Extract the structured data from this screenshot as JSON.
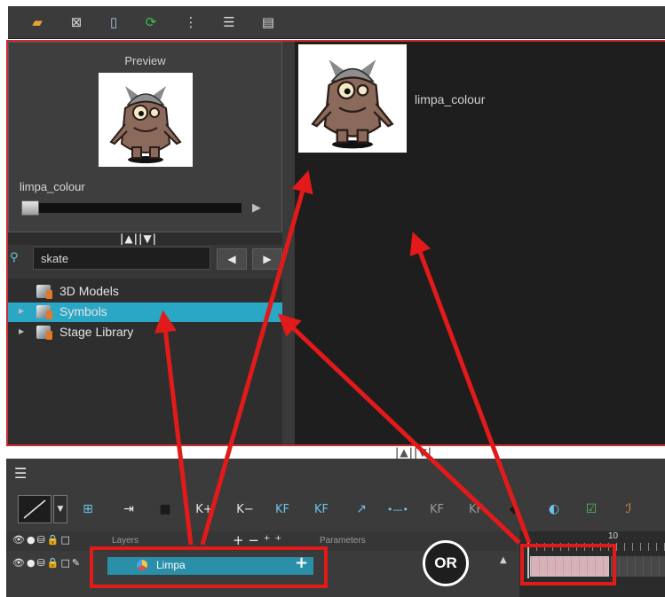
{
  "toolbar": {
    "icons": [
      "folder-open-icon",
      "export-icon",
      "library-icon",
      "refresh-icon",
      "tree-view-icon",
      "list-view-icon",
      "thumbnail-view-icon"
    ]
  },
  "preview": {
    "label": "Preview",
    "name": "limpa_colour",
    "play_glyph": "▶"
  },
  "splitter": {
    "glyph": "|▲||▼|"
  },
  "search": {
    "value": "skate"
  },
  "nav": {
    "prev": "◀",
    "next": "▶"
  },
  "tree": {
    "items": [
      {
        "label": "3D Models",
        "expandable": false
      },
      {
        "label": "Symbols",
        "expandable": true,
        "selected": true
      },
      {
        "label": "Stage Library",
        "expandable": true
      }
    ],
    "expand_glyph": "▶"
  },
  "viewer": {
    "item_name": "limpa_colour"
  },
  "timeline": {
    "menu_glyph": "☰",
    "tools": [
      {
        "name": "create-drawing-button",
        "glyph": "⊞"
      },
      {
        "name": "convert-button",
        "glyph": "⇥"
      },
      {
        "name": "library-button",
        "glyph": "■"
      },
      {
        "name": "add-keyframe-button",
        "glyph": "K+"
      },
      {
        "name": "remove-keyframe-button",
        "glyph": "K−"
      },
      {
        "name": "add-keyframe-kf-button",
        "glyph": "KF"
      },
      {
        "name": "remove-keyframe-kf-button",
        "glyph": "KF"
      },
      {
        "name": "motion-path-button",
        "glyph": "↗"
      },
      {
        "name": "constant-segment-button",
        "glyph": "•—•"
      },
      {
        "name": "previous-keyframe-button",
        "glyph": "KF"
      },
      {
        "name": "next-keyframe-button",
        "glyph": "KF"
      },
      {
        "name": "clear-button",
        "glyph": "◆"
      },
      {
        "name": "onion-skin-button",
        "glyph": "◐"
      },
      {
        "name": "checkmark-button",
        "glyph": "☑"
      },
      {
        "name": "ease-button",
        "glyph": "ℐ"
      }
    ],
    "layers_label": "Layers",
    "params_label": "Parameters",
    "header_icons": "👁●⛁🔒□",
    "header_add": "+ − ⁺ ⁺",
    "row_icons": "👁●⛁🔒□✎",
    "layer_name": "Limpa",
    "layer_add": "+",
    "or_label": "OR",
    "frame_label": "10",
    "scroll_up": "▲"
  },
  "colors": {
    "accent": "#2aa7c4",
    "annotation_red": "#e21a1a"
  }
}
